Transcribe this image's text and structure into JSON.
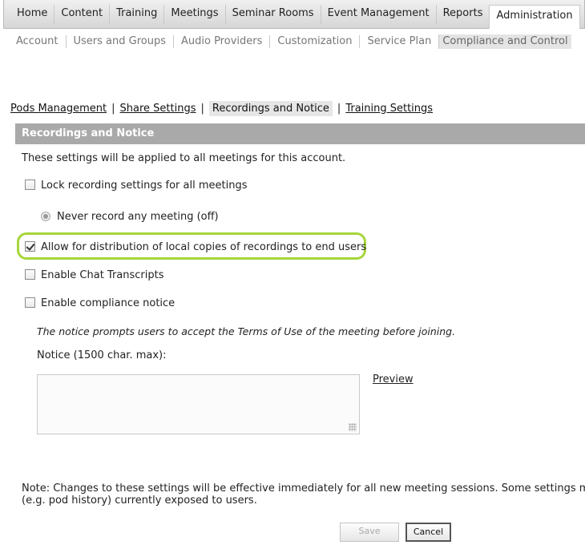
{
  "top_nav": {
    "tabs": [
      "Home",
      "Content",
      "Training",
      "Meetings",
      "Seminar Rooms",
      "Event Management",
      "Reports",
      "Administration"
    ],
    "active": "Administration"
  },
  "sub_nav": {
    "items": [
      "Account",
      "Users and Groups",
      "Audio Providers",
      "Customization",
      "Service Plan",
      "Compliance and Control"
    ],
    "active": "Compliance and Control"
  },
  "section_tabs": {
    "items": [
      "Pods Management",
      "Share Settings",
      "Recordings and Notice",
      "Training Settings"
    ],
    "separator": "|",
    "active": "Recordings and Notice"
  },
  "section": {
    "title": "Recordings and Notice",
    "intro": "These settings will be applied to all meetings for this account.",
    "lock_recording_label": "Lock recording settings for all meetings",
    "never_record_label": "Never record any meeting (off)",
    "allow_distribution_label": "Allow for distribution of local copies of recordings to end users",
    "enable_chat_label": "Enable Chat Transcripts",
    "enable_compliance_label": "Enable compliance notice",
    "notice_hint": "The notice prompts users to accept the Terms of Use of the meeting before joining.",
    "notice_label": "Notice (1500 char. max):",
    "notice_value": "",
    "preview_label": "Preview",
    "note_line1": "Note: Changes to these settings will be effective immediately for all new meeting sessions. Some settings may",
    "note_line2": "(e.g. pod history) currently exposed to users."
  },
  "checkboxes": {
    "lock_recording": false,
    "allow_distribution": true,
    "enable_chat": false,
    "enable_compliance": false
  },
  "buttons": {
    "save": "Save",
    "cancel": "Cancel"
  },
  "colors": {
    "section_bar": "#a9a9a9",
    "highlight": "#a6d63a"
  }
}
